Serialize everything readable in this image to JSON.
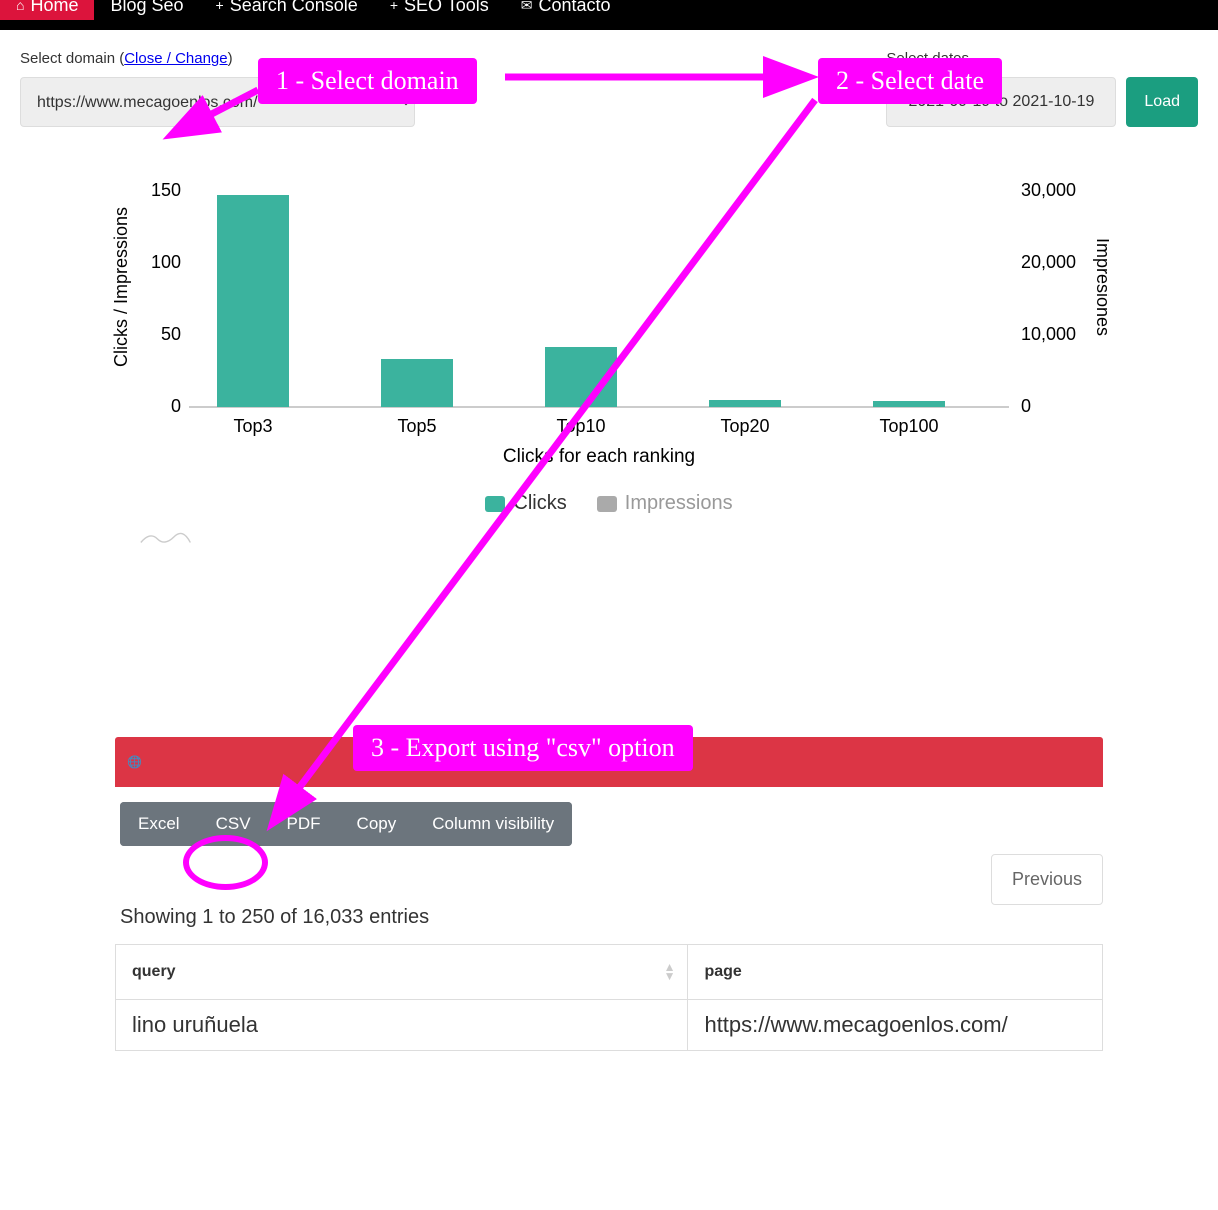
{
  "nav": {
    "home": "Home",
    "blog": "Blog Seo",
    "search_console": "Search Console",
    "seo_tools": "SEO Tools",
    "contacto": "Contacto"
  },
  "controls": {
    "select_domain_label_prefix": "Select domain (",
    "close_change_link": "Close / Change",
    "select_domain_label_suffix": ")",
    "domain_value": "https://www.mecagoenlos.com/",
    "select_dates_label": "Select dates",
    "date_value": "2021-09-19 to 2021-10-19",
    "load_label": "Load"
  },
  "annotations": {
    "step1": "1 - Select domain",
    "step2": "2 - Select date",
    "step3": "3 - Export using \"csv\" option"
  },
  "chart_data": {
    "type": "bar",
    "categories": [
      "Top3",
      "Top5",
      "Top10",
      "Top20",
      "Top100"
    ],
    "series": [
      {
        "name": "Clicks",
        "values": [
          147,
          33,
          42,
          5,
          4
        ],
        "axis": "left",
        "color": "#3bb39e"
      },
      {
        "name": "Impressions",
        "values": null,
        "axis": "right",
        "color": "#aaa",
        "visible": false
      }
    ],
    "title": "Clicks for each ranking",
    "yleft_label": "Clicks / Impressions",
    "yright_label": "Impresiones",
    "yleft_ticks": [
      0,
      50,
      100,
      150
    ],
    "yright_ticks": [
      0,
      10000,
      20000,
      30000
    ],
    "yright_tick_labels": [
      "0",
      "10,000",
      "20,000",
      "30,000"
    ],
    "ylim_left": [
      0,
      155
    ],
    "legend": [
      "Clicks",
      "Impressions"
    ]
  },
  "dt": {
    "buttons": {
      "excel": "Excel",
      "csv": "CSV",
      "pdf": "PDF",
      "copy": "Copy",
      "colvis": "Column visibility"
    },
    "previous": "Previous",
    "info": "Showing 1 to 250 of 16,033 entries",
    "columns": {
      "query": "query",
      "page": "page"
    },
    "rows": [
      {
        "query": "lino uruñuela",
        "page": "https://www.mecagoenlos.com/"
      }
    ]
  }
}
